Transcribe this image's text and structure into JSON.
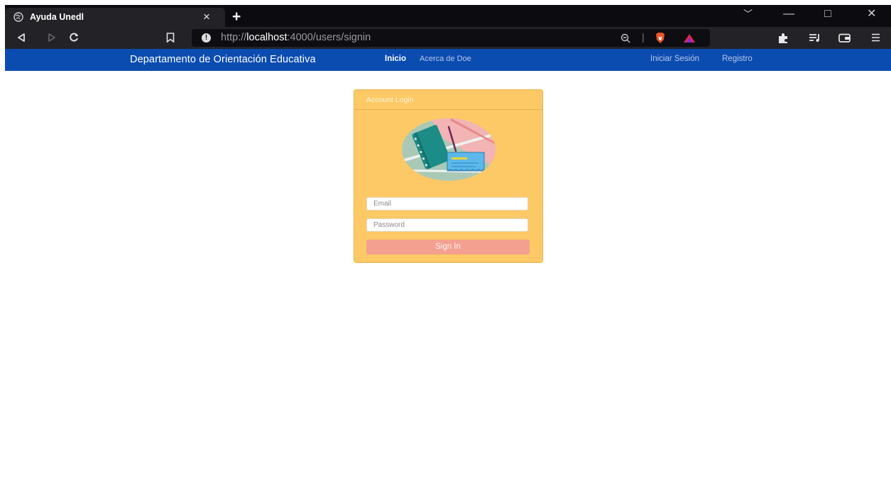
{
  "browser": {
    "tab_title": "Ayuda Unedl",
    "tab_close": "×",
    "new_tab": "+",
    "url_scheme": "http://",
    "url_host": "localhost",
    "url_rest": ":4000/users/signin",
    "window_controls": {
      "minimize": "—",
      "maximize": "□",
      "close": "✕",
      "tab_list": "﹀"
    }
  },
  "navbar": {
    "brand": "Departamento de Orientación Educativa",
    "links": [
      "Inicio",
      "Acerca de Doe"
    ],
    "right_links": [
      "Iniciar Sesión",
      "Registro"
    ]
  },
  "login": {
    "title": "Account Login",
    "email_placeholder": "Email",
    "password_placeholder": "Password",
    "submit_label": "Sign In"
  },
  "colors": {
    "navbar": "#0b4cb0",
    "card": "#fcc966",
    "button": "#f4a090"
  }
}
